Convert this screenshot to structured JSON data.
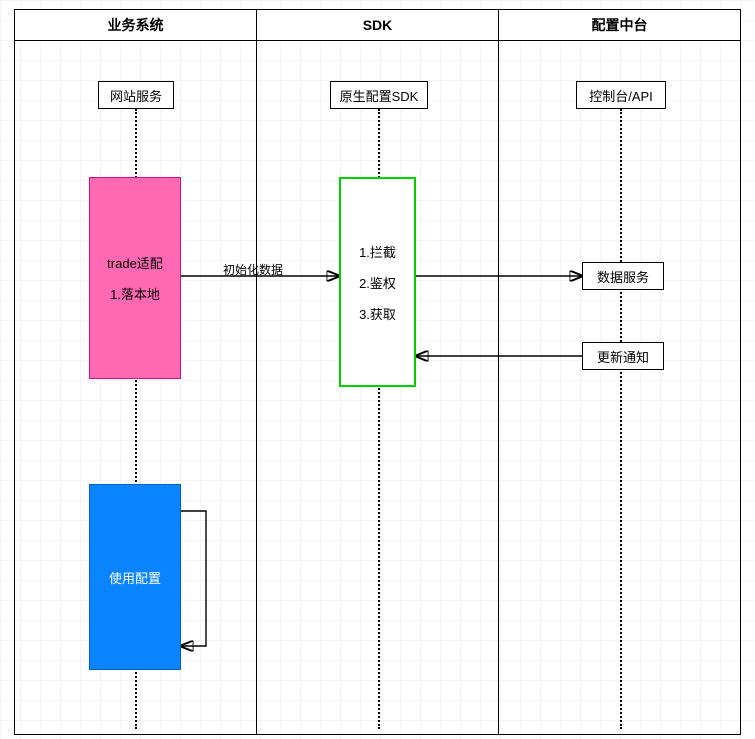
{
  "lanes": {
    "biz": {
      "title": "业务系统"
    },
    "sdk": {
      "title": "SDK"
    },
    "config": {
      "title": "配置中台"
    }
  },
  "nodes": {
    "web_service": "网站服务",
    "native_sdk": "原生配置SDK",
    "console_api": "控制台/API",
    "trade_adapter": {
      "title": "trade适配",
      "step1": "1.落本地"
    },
    "sdk_core": {
      "step1": "1.拦截",
      "step2": "2.鉴权",
      "step3": "3.获取"
    },
    "data_service": "数据服务",
    "update_notify": "更新通知",
    "use_config": "使用配置"
  },
  "edges": {
    "init_data": "初始化数据"
  },
  "chart_data": {
    "type": "sequence/flow",
    "title": "",
    "lanes": [
      "业务系统",
      "SDK",
      "配置中台"
    ],
    "actors": [
      {
        "lane": "业务系统",
        "name": "网站服务"
      },
      {
        "lane": "SDK",
        "name": "原生配置SDK"
      },
      {
        "lane": "配置中台",
        "name": "控制台/API"
      }
    ],
    "activations": [
      {
        "lane": "业务系统",
        "label": "trade适配",
        "steps": [
          "1.落本地"
        ],
        "color": "pink"
      },
      {
        "lane": "SDK",
        "label": "",
        "steps": [
          "1.拦截",
          "2.鉴权",
          "3.获取"
        ],
        "color": "green"
      },
      {
        "lane": "业务系统",
        "label": "使用配置",
        "steps": [],
        "color": "blue"
      }
    ],
    "messages": [
      {
        "from": "trade适配",
        "to": "SDK核心",
        "label": "初始化数据",
        "dir": "right"
      },
      {
        "from": "SDK核心",
        "to": "数据服务",
        "label": "",
        "dir": "right"
      },
      {
        "from": "更新通知",
        "to": "SDK核心",
        "label": "",
        "dir": "left"
      },
      {
        "from": "使用配置",
        "to": "使用配置",
        "label": "",
        "dir": "self"
      }
    ],
    "side_nodes": [
      {
        "lane": "配置中台",
        "name": "数据服务"
      },
      {
        "lane": "配置中台",
        "name": "更新通知"
      }
    ]
  }
}
